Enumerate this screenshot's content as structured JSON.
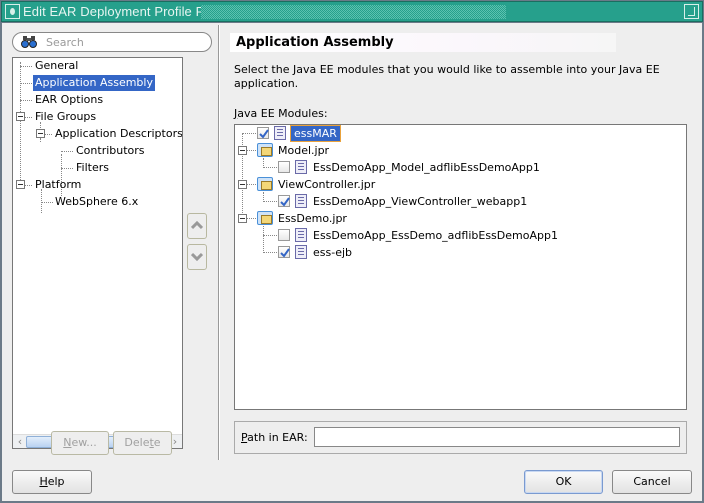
{
  "window": {
    "title": "Edit EAR Deployment Profile Properties"
  },
  "search": {
    "placeholder": "Search",
    "value": ""
  },
  "nav": {
    "items": [
      {
        "label": "General",
        "selected": false
      },
      {
        "label": "Application Assembly",
        "selected": true
      },
      {
        "label": "EAR Options",
        "selected": false
      },
      {
        "label": "File Groups",
        "expanded": true
      },
      {
        "label": "Application Descriptors",
        "expanded": true
      },
      {
        "label": "Contributors"
      },
      {
        "label": "Filters"
      },
      {
        "label": "Platform",
        "expanded": true
      },
      {
        "label": "WebSphere 6.x"
      }
    ],
    "new_label_underlined": "N",
    "new_label_rest": "ew...",
    "delete_label_pre": "Dele",
    "delete_label_underlined": "t",
    "delete_label_post": "e"
  },
  "main": {
    "section_title": "Application Assembly",
    "description": "Select the Java EE modules that you would like to assemble into your Java EE application.",
    "modules_label_underlined": "J",
    "modules_label_rest": "ava EE Modules:",
    "modules": [
      {
        "label": "essMAR",
        "type": "module",
        "checked": true,
        "selected": true
      },
      {
        "label": "Model.jpr",
        "type": "project",
        "expanded": true
      },
      {
        "label": "EssDemoApp_Model_adflibEssDemoApp1",
        "type": "module",
        "checked": false
      },
      {
        "label": "ViewController.jpr",
        "type": "project",
        "expanded": true
      },
      {
        "label": "EssDemoApp_ViewController_webapp1",
        "type": "module",
        "checked": true
      },
      {
        "label": "EssDemo.jpr",
        "type": "project",
        "expanded": true
      },
      {
        "label": "EssDemoApp_EssDemo_adflibEssDemoApp1",
        "type": "module",
        "checked": false
      },
      {
        "label": "ess-ejb",
        "type": "module",
        "checked": true
      }
    ],
    "path_label_underlined": "P",
    "path_label_rest": "ath in EAR:",
    "path_value": ""
  },
  "footer": {
    "help_underlined": "H",
    "help_rest": "elp",
    "ok_label": "OK",
    "cancel_label": "Cancel"
  }
}
